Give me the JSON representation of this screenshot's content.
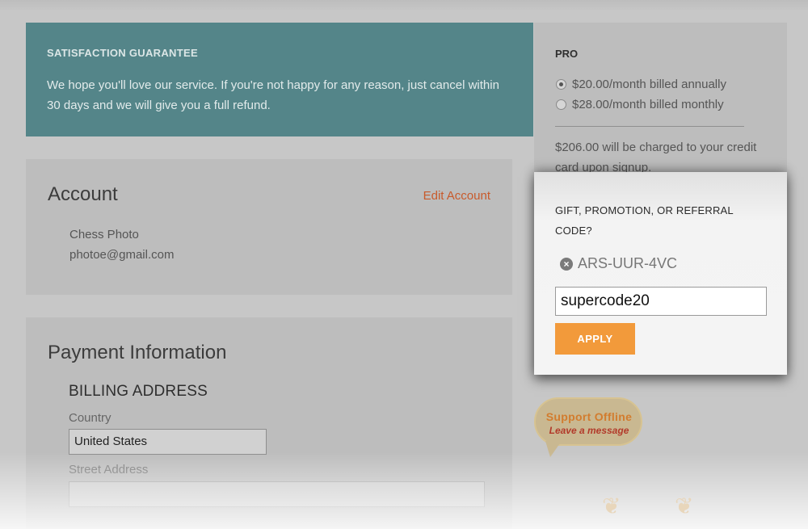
{
  "guarantee": {
    "heading": "SATISFACTION GUARANTEE",
    "body": "We hope you'll love our service. If you're not happy for any reason, just cancel within 30 days and we will give you a full refund."
  },
  "account": {
    "title": "Account",
    "edit_label": "Edit Account",
    "name": "Chess Photo",
    "email": "photoe@gmail.com"
  },
  "payment": {
    "title": "Payment Information",
    "billing_heading": "BILLING ADDRESS",
    "country_label": "Country",
    "country_value": "United States",
    "street_label": "Street Address",
    "street_value": ""
  },
  "plan": {
    "heading": "PRO",
    "options": [
      {
        "label": "$20.00/month billed annually",
        "selected": true
      },
      {
        "label": "$28.00/month billed monthly",
        "selected": false
      }
    ],
    "charge_note": "$206.00 will be charged to your credit card upon signup."
  },
  "promo": {
    "heading": "GIFT, PROMOTION, OR REFERRAL CODE?",
    "applied_code": "ARS-UUR-4VC",
    "input_value": "supercode20",
    "apply_label": "APPLY"
  },
  "support": {
    "line1": "Support Offline",
    "line2": "Leave a message"
  },
  "colors": {
    "guarantee_bg": "#548589",
    "edit_link": "#c85a2b",
    "apply_button": "#f29a3b"
  }
}
